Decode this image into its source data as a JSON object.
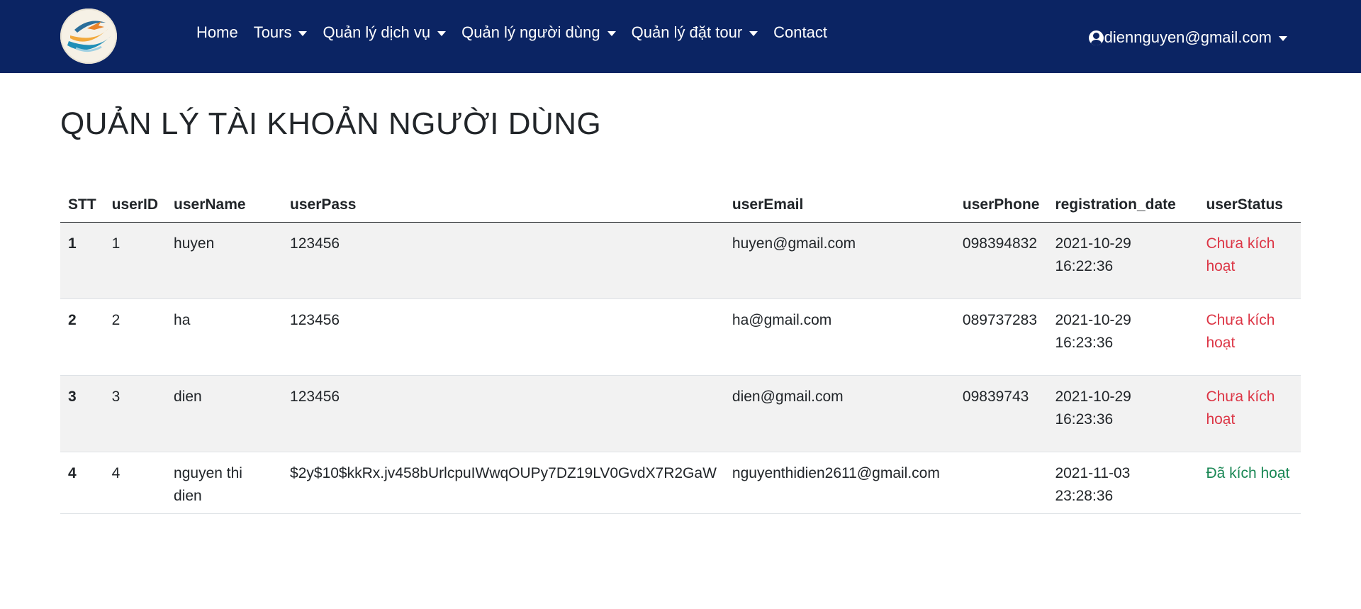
{
  "navbar": {
    "links": [
      {
        "label": "Home",
        "dropdown": false
      },
      {
        "label": "Tours",
        "dropdown": true
      },
      {
        "label": "Quản lý dịch vụ",
        "dropdown": true
      },
      {
        "label": "Quản lý người dùng",
        "dropdown": true
      },
      {
        "label": "Quản lý đặt tour",
        "dropdown": true
      },
      {
        "label": "Contact",
        "dropdown": false
      }
    ],
    "user_email": "diennguyen@gmail.com",
    "colors": {
      "background": "#0b2463",
      "text": "#ffffff"
    }
  },
  "page": {
    "title": "QUẢN LÝ TÀI KHOẢN NGƯỜI DÙNG"
  },
  "table": {
    "headers": [
      "STT",
      "userID",
      "userName",
      "userPass",
      "userEmail",
      "userPhone",
      "registration_date",
      "userStatus"
    ],
    "rows": [
      {
        "stt": "1",
        "userID": "1",
        "userName": "huyen",
        "userPass": "123456",
        "userEmail": "huyen@gmail.com",
        "userPhone": "098394832",
        "date": "2021-10-29",
        "time": "16:22:36",
        "status_line1": "Chưa kích",
        "status_line2": "hoạt",
        "status_type": "inactive"
      },
      {
        "stt": "2",
        "userID": "2",
        "userName": "ha",
        "userPass": "123456",
        "userEmail": "ha@gmail.com",
        "userPhone": "089737283",
        "date": "2021-10-29",
        "time": "16:23:36",
        "status_line1": "Chưa kích",
        "status_line2": "hoạt",
        "status_type": "inactive"
      },
      {
        "stt": "3",
        "userID": "3",
        "userName": "dien",
        "userPass": "123456",
        "userEmail": "dien@gmail.com",
        "userPhone": "09839743",
        "date": "2021-10-29",
        "time": "16:23:36",
        "status_line1": "Chưa kích",
        "status_line2": "hoạt",
        "status_type": "inactive"
      },
      {
        "stt": "4",
        "userID": "4",
        "userName": "nguyen thi dien",
        "userPass": "$2y$10$kkRx.jv458bUrlcpuIWwqOUPy7DZ19LV0GvdX7R2GaW",
        "userEmail": "nguyenthidien2611@gmail.com",
        "userPhone": "",
        "date": "2021-11-03",
        "time": "23:28:36",
        "status_line1": "Đã kích hoạt",
        "status_line2": "",
        "status_type": "active"
      }
    ],
    "status_colors": {
      "inactive": "#dc3545",
      "active": "#198754"
    }
  }
}
